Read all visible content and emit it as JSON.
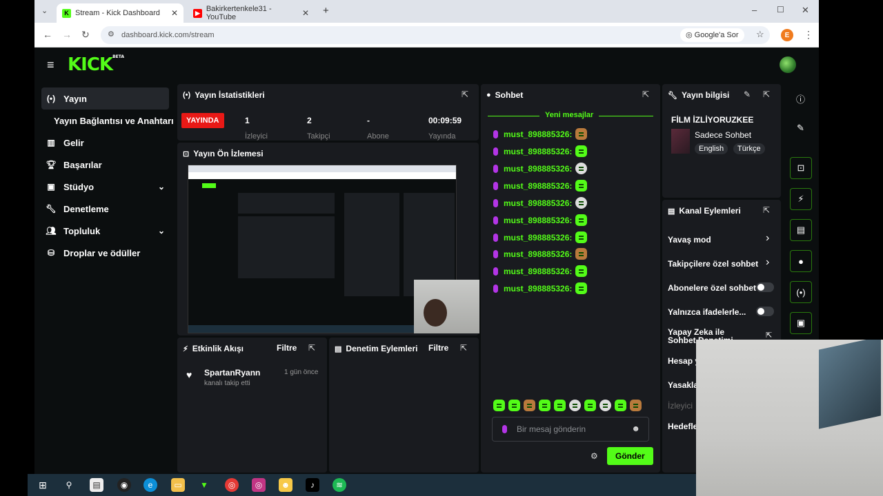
{
  "browser": {
    "tabs": [
      {
        "title": "Stream - Kick Dashboard"
      },
      {
        "title": "Bakirkertenkele31 - YouTube"
      }
    ],
    "url": "dashboard.kick.com/stream",
    "google_btn": "Google'a Sor",
    "profile_initial": "E"
  },
  "kick": {
    "logo": "KICK",
    "logo_badge": "BETA"
  },
  "sidebar": {
    "items": [
      {
        "label": "Yayın",
        "icon": "broadcast-icon"
      },
      {
        "label": "Yayın Bağlantısı ve Anahtarı",
        "icon": ""
      },
      {
        "label": "Gelir",
        "icon": "chart-icon"
      },
      {
        "label": "Başarılar",
        "icon": "trophy-icon"
      },
      {
        "label": "Stüdyo",
        "icon": "studio-icon"
      },
      {
        "label": "Denetleme",
        "icon": "wrench-icon"
      },
      {
        "label": "Topluluk",
        "icon": "community-icon"
      },
      {
        "label": "Droplar ve ödüller",
        "icon": "drops-icon"
      }
    ]
  },
  "stats": {
    "title": "Yayın İstatistikleri",
    "live_badge": "YAYINDA",
    "items": [
      {
        "value": "1",
        "label": "İzleyici"
      },
      {
        "value": "2",
        "label": "Takipçi"
      },
      {
        "value": "-",
        "label": "Abone"
      },
      {
        "value": "00:09:59",
        "label": "Yayında"
      }
    ]
  },
  "preview": {
    "title": "Yayın Ön İzlemesi"
  },
  "activity": {
    "title": "Etkinlik Akışı",
    "filter": "Filtre",
    "event_user": "SpartanRyann",
    "event_text": "kanalı takip etti",
    "event_time": "1 gün önce"
  },
  "moderation": {
    "title": "Denetim Eylemleri",
    "filter": "Filtre"
  },
  "chat": {
    "title": "Sohbet",
    "new_messages": "Yeni mesajlar",
    "messages": [
      {
        "user": "must_898885326:"
      },
      {
        "user": "must_898885326:"
      },
      {
        "user": "must_898885326:"
      },
      {
        "user": "must_898885326:"
      },
      {
        "user": "must_898885326:"
      },
      {
        "user": "must_898885326:"
      },
      {
        "user": "must_898885326:"
      },
      {
        "user": "must_898885326:"
      },
      {
        "user": "must_898885326:"
      },
      {
        "user": "must_898885326:"
      }
    ],
    "placeholder": "Bir mesaj gönderin",
    "send": "Gönder"
  },
  "stream_info": {
    "title": "Yayın bilgisi",
    "stream_title": "FİLM İZLİYORUZKEE",
    "category": "Sadece Sohbet",
    "tags": [
      "English",
      "Türkçe"
    ]
  },
  "channel_actions": {
    "title": "Kanal Eylemleri",
    "items": [
      {
        "label": "Yavaş mod"
      },
      {
        "label": "Takipçilere özel sohbet"
      },
      {
        "label": "Abonelere özel sohbet"
      },
      {
        "label": "Yalnızca ifadelerle..."
      },
      {
        "label": "Yapay Zeka ile Sohbet Denetimi"
      },
      {
        "label": "Hesap y"
      },
      {
        "label": "Yasakla"
      },
      {
        "label": "İzleyici"
      },
      {
        "label": "Hedefle"
      }
    ]
  },
  "colors": {
    "accent": "#53fc18",
    "panel": "#191b1f",
    "live": "#e91916"
  }
}
